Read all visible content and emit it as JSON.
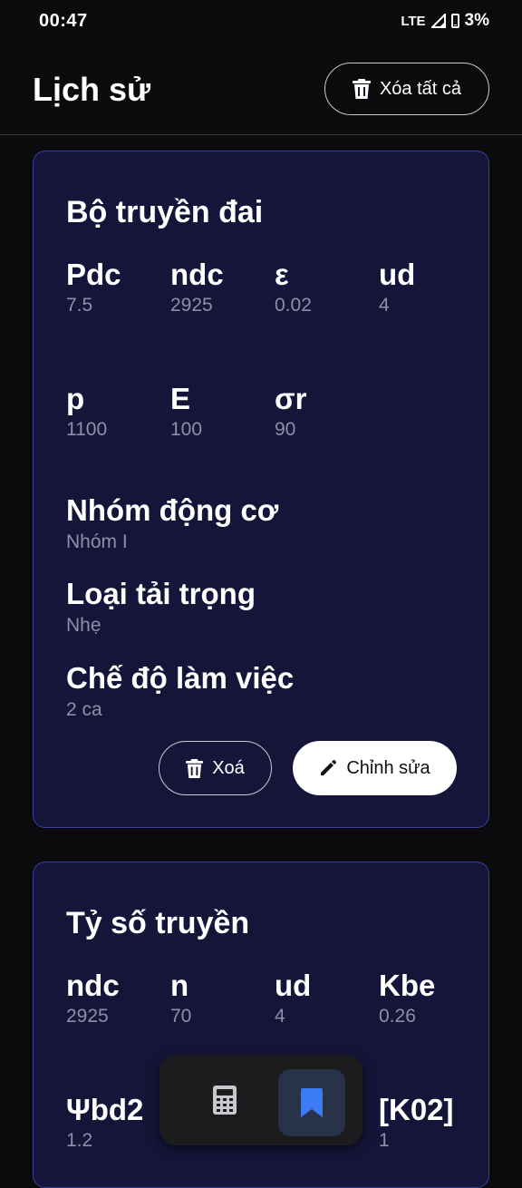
{
  "status_bar": {
    "time": "00:47",
    "network": "LTE",
    "battery": "3%"
  },
  "header": {
    "title": "Lịch sử",
    "clear_all_label": "Xóa tất cả"
  },
  "cards": [
    {
      "title": "Bộ truyền đai",
      "params": [
        {
          "name": "Pdc",
          "value": "7.5"
        },
        {
          "name": "ndc",
          "value": "2925"
        },
        {
          "name": "ε",
          "value": "0.02"
        },
        {
          "name": "ud",
          "value": "4"
        },
        {
          "name": "p",
          "value": "1100"
        },
        {
          "name": "E",
          "value": "100"
        },
        {
          "name": "σr",
          "value": "90"
        }
      ],
      "info": [
        {
          "label": "Nhóm động cơ",
          "value": "Nhóm I"
        },
        {
          "label": "Loại tải trọng",
          "value": "Nhẹ"
        },
        {
          "label": "Chế độ làm việc",
          "value": "2 ca"
        }
      ],
      "delete_label": "Xoá",
      "edit_label": "Chỉnh sửa"
    },
    {
      "title": "Tỷ số truyền",
      "params": [
        {
          "name": "ndc",
          "value": "2925"
        },
        {
          "name": "n",
          "value": "70"
        },
        {
          "name": "ud",
          "value": "4"
        },
        {
          "name": "Kbe",
          "value": "0.26"
        },
        {
          "name": "Ψbd2",
          "value": "1.2"
        },
        {
          "name": "[K02]",
          "value": "1"
        }
      ]
    }
  ],
  "nav": {
    "items": [
      "calculator-icon",
      "bookmark-icon"
    ],
    "active": "bookmark-icon",
    "accent": "#3d7bf5"
  }
}
